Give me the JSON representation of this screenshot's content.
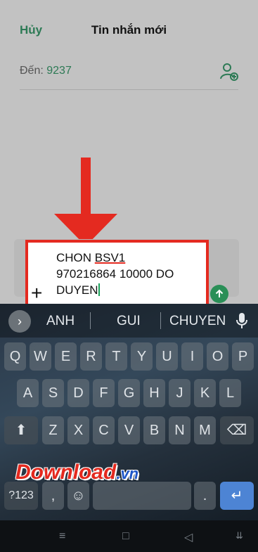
{
  "header": {
    "cancel_label": "Hủy",
    "title": "Tin nhắn mới"
  },
  "to": {
    "label": "Đến:",
    "number": "9237"
  },
  "message": {
    "line1_plain": "CHON ",
    "line1_underlined": "BSV1",
    "line2": "970216864 10000 DO",
    "line3": "DUYEN"
  },
  "compose": {
    "plus_label": "+"
  },
  "suggestions": {
    "chevron": "›",
    "items": [
      "ANH",
      "GUI",
      "CHUYEN"
    ]
  },
  "keyboard": {
    "row1": [
      "Q",
      "W",
      "E",
      "R",
      "T",
      "Y",
      "U",
      "I",
      "O",
      "P"
    ],
    "row2": [
      "A",
      "S",
      "D",
      "F",
      "G",
      "H",
      "J",
      "K",
      "L"
    ],
    "row3": [
      "Z",
      "X",
      "C",
      "V",
      "B",
      "N",
      "M"
    ],
    "symbols_label": "?123",
    "comma_label": ",",
    "period_label": ".",
    "emoji_label": "☺",
    "shift_label": "⬆",
    "backspace_label": "⌫",
    "enter_label": "↵"
  },
  "watermark": {
    "text": "Download",
    "suffix": ".vn"
  },
  "nav": {
    "menu": "≡",
    "home": "□",
    "back": "◁",
    "extra": "⇊"
  },
  "colors": {
    "accent_green": "#2d7a55",
    "highlight_red": "#e42a20",
    "enter_blue": "#4d84d4"
  }
}
